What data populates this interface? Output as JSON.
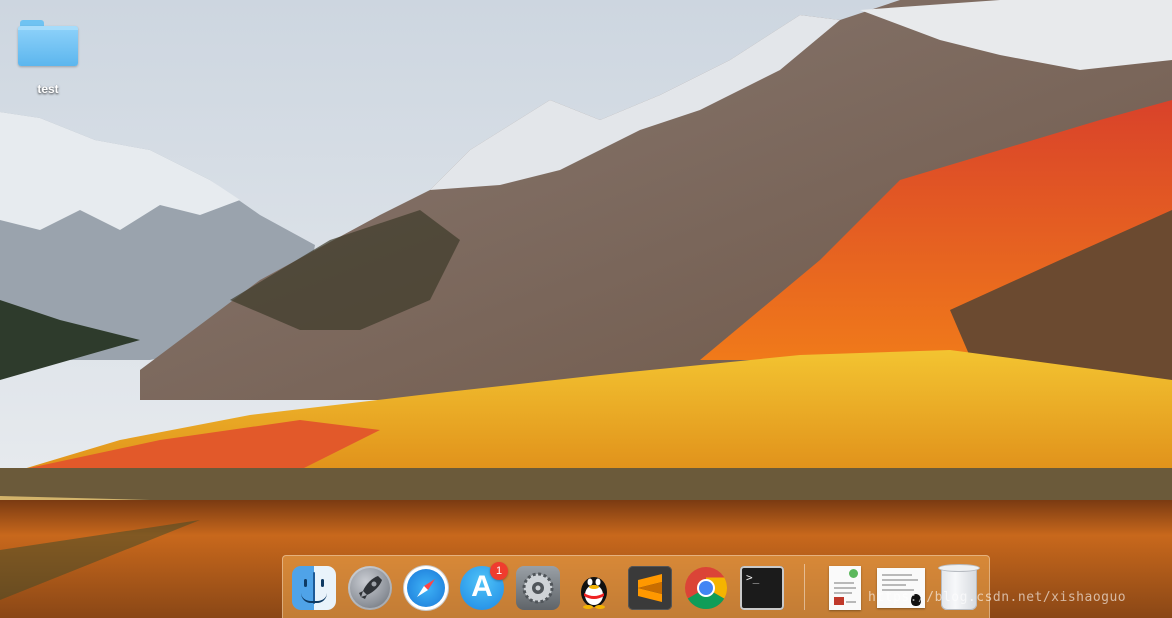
{
  "desktop": {
    "icons": [
      {
        "label": "test",
        "icon": "folder-icon"
      }
    ]
  },
  "dock": {
    "apps": [
      {
        "name": "Finder",
        "icon": "finder-icon"
      },
      {
        "name": "Launchpad",
        "icon": "rocket-icon"
      },
      {
        "name": "Safari",
        "icon": "compass-icon"
      },
      {
        "name": "App Store",
        "icon": "app-store-icon",
        "badge": "1"
      },
      {
        "name": "System Preferences",
        "icon": "gear-icon"
      },
      {
        "name": "QQ",
        "icon": "qq-penguin-icon"
      },
      {
        "name": "Sublime Text",
        "icon": "sublime-icon"
      },
      {
        "name": "Google Chrome",
        "icon": "chrome-icon"
      },
      {
        "name": "Terminal",
        "icon": "terminal-icon",
        "prompt": ">_"
      }
    ],
    "right": [
      {
        "name": "document",
        "icon": "document-icon"
      },
      {
        "name": "screenshot",
        "icon": "document-icon"
      },
      {
        "name": "Trash",
        "icon": "trash-icon"
      }
    ]
  },
  "watermark": "https://blog.csdn.net/xishaoguo",
  "colors": {
    "sky": "#d9dde2",
    "foliage_orange": "#e8641e",
    "foliage_yellow": "#f0b51e",
    "water": "#b5611b",
    "folder_blue": "#6cc0f2",
    "badge_red": "#f03c2e"
  }
}
